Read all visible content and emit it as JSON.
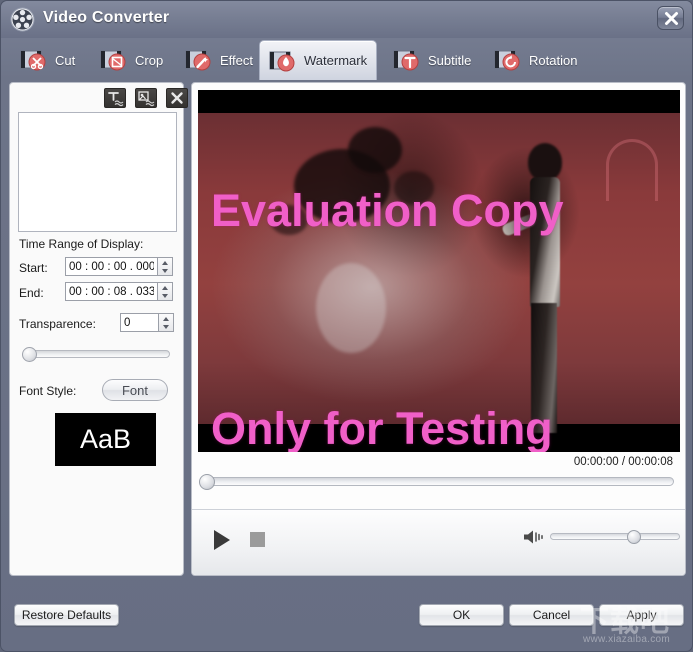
{
  "window": {
    "title": "Video Converter",
    "logo_icon": "film-reel-icon",
    "close_icon": "close-icon"
  },
  "tabs": [
    {
      "label": "Cut",
      "icon": "scissors-icon",
      "active": false
    },
    {
      "label": "Crop",
      "icon": "crop-icon",
      "active": false
    },
    {
      "label": "Effect",
      "icon": "magic-wand-icon",
      "active": false
    },
    {
      "label": "Watermark",
      "icon": "water-drop-icon",
      "active": true
    },
    {
      "label": "Subtitle",
      "icon": "text-t-icon",
      "active": false
    },
    {
      "label": "Rotation",
      "icon": "rotate-icon",
      "active": false
    }
  ],
  "left_panel": {
    "tools": [
      {
        "name": "add-text-watermark",
        "icon": "text-watermark-icon"
      },
      {
        "name": "add-image-watermark",
        "icon": "image-watermark-icon"
      },
      {
        "name": "delete-watermark",
        "icon": "close-icon"
      }
    ],
    "watermark_list": {
      "items": []
    },
    "time_range_label": "Time Range of Display:",
    "start_label": "Start:",
    "start_value": "00 : 00 : 00 . 000",
    "end_label": "End:",
    "end_value": "00 : 00 : 08 . 033",
    "transparence_label": "Transparence:",
    "transparence_value": "0",
    "transparence_slider_percent": 0,
    "font_style_label": "Font Style:",
    "font_button_label": "Font",
    "font_preview_text": "AaB"
  },
  "preview": {
    "watermark_line1": "Evaluation Copy",
    "watermark_line2": "Only for Testing",
    "watermark_color": "#f05fc8",
    "time_display": "00:00:00 / 00:00:08",
    "seek_percent": 0,
    "play_icon": "play-icon",
    "stop_icon": "stop-icon",
    "volume_icon": "volume-icon",
    "volume_percent": 60
  },
  "bottom_bar": {
    "restore_defaults": "Restore Defaults",
    "ok": "OK",
    "cancel": "Cancel",
    "apply": "Apply"
  },
  "site_watermark": {
    "text_cn": "下载吧",
    "url": "www.xiazaiba.com"
  }
}
